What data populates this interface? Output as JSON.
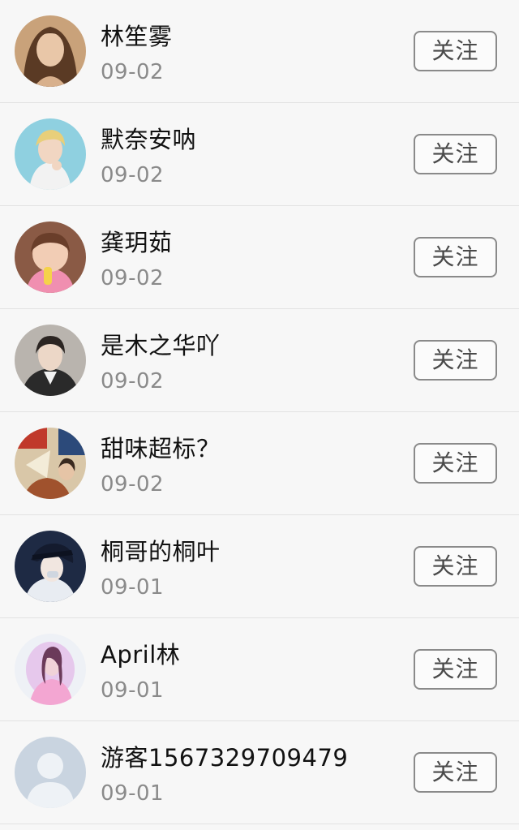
{
  "follow_label": "关注",
  "users": [
    {
      "name": "林笙雾",
      "date": "09-02",
      "avatar": "portrait-woman-brown-hair"
    },
    {
      "name": "默奈安呐",
      "date": "09-02",
      "avatar": "portrait-blond-boy"
    },
    {
      "name": "龚玥茹",
      "date": "09-02",
      "avatar": "portrait-child-banana"
    },
    {
      "name": "是木之华吖",
      "date": "09-02",
      "avatar": "portrait-boy-dark-hoodie"
    },
    {
      "name": "甜味超标？",
      "date": "09-02",
      "avatar": "portrait-woman-colorful"
    },
    {
      "name": "桐哥的桐叶",
      "date": "09-01",
      "avatar": "anime-boy-cap"
    },
    {
      "name": "April林",
      "date": "09-01",
      "avatar": "portrait-girl-pink"
    },
    {
      "name": "游客1567329709479",
      "date": "09-01",
      "avatar": "default-user-silhouette"
    }
  ]
}
